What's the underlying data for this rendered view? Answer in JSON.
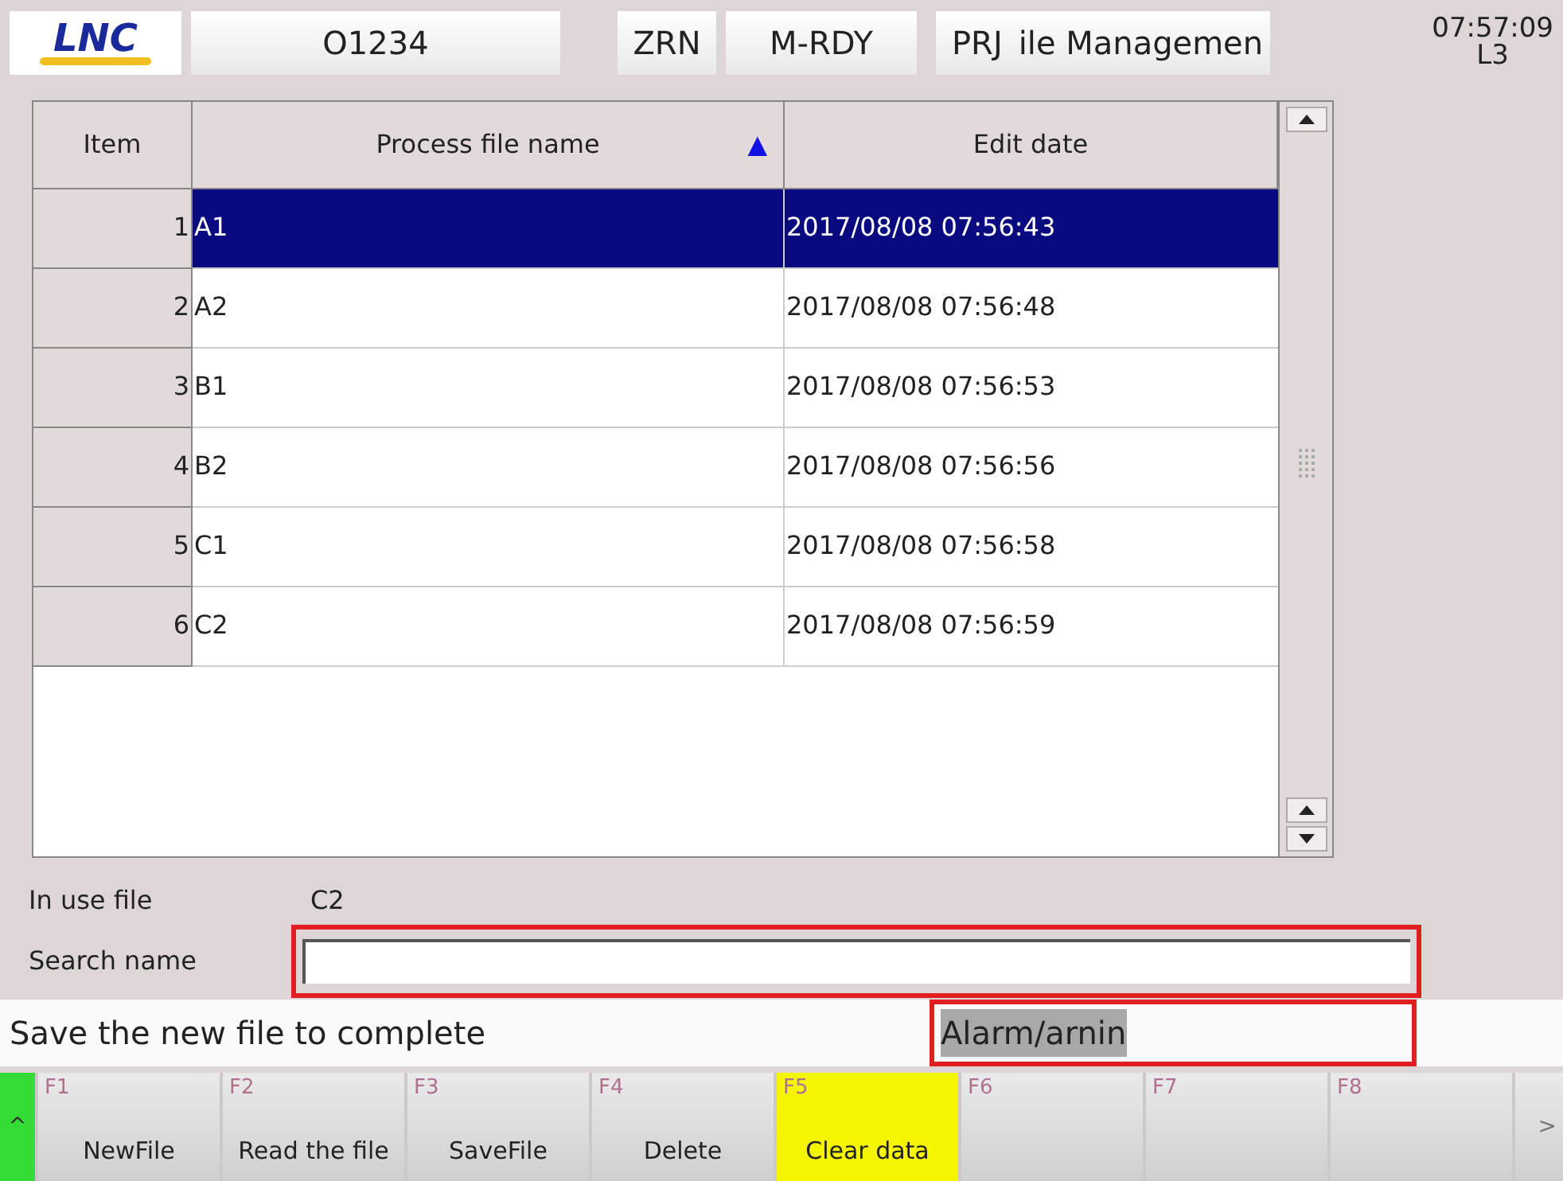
{
  "header": {
    "logo": "LNC",
    "program": "O1234",
    "mode": "ZRN",
    "status": "M-RDY",
    "section": "PRJ",
    "title": "ile Managemen",
    "time": "07:57:09",
    "level": "L3"
  },
  "table": {
    "columns": [
      {
        "label": "Item"
      },
      {
        "label": "Process file name",
        "sort_indicator": "▲"
      },
      {
        "label": "Edit date"
      }
    ],
    "rows": [
      {
        "item": "1",
        "name": "A1",
        "date": "2017/08/08 07:56:43",
        "selected": true
      },
      {
        "item": "2",
        "name": "A2",
        "date": "2017/08/08 07:56:48",
        "selected": false
      },
      {
        "item": "3",
        "name": "B1",
        "date": "2017/08/08 07:56:53",
        "selected": false
      },
      {
        "item": "4",
        "name": "B2",
        "date": "2017/08/08 07:56:56",
        "selected": false
      },
      {
        "item": "5",
        "name": "C1",
        "date": "2017/08/08 07:56:58",
        "selected": false
      },
      {
        "item": "6",
        "name": "C2",
        "date": "2017/08/08 07:56:59",
        "selected": false
      }
    ]
  },
  "in_use": {
    "label": "In use file",
    "value": "C2"
  },
  "search": {
    "label": "Search name"
  },
  "status_bar": {
    "message": "Save the new file to complete",
    "alarm": "Alarm/arnin"
  },
  "function_keys": {
    "left": "^",
    "right": ">",
    "keys": [
      {
        "key": "F1",
        "label": "NewFile",
        "highlighted": false
      },
      {
        "key": "F2",
        "label": "Read the file",
        "highlighted": false
      },
      {
        "key": "F3",
        "label": "SaveFile",
        "highlighted": false
      },
      {
        "key": "F4",
        "label": "Delete",
        "highlighted": false
      },
      {
        "key": "F5",
        "label": "Clear data",
        "highlighted": true
      },
      {
        "key": "F6",
        "highlighted": false
      },
      {
        "key": "F7",
        "highlighted": false
      },
      {
        "key": "F8",
        "highlighted": false
      }
    ]
  }
}
